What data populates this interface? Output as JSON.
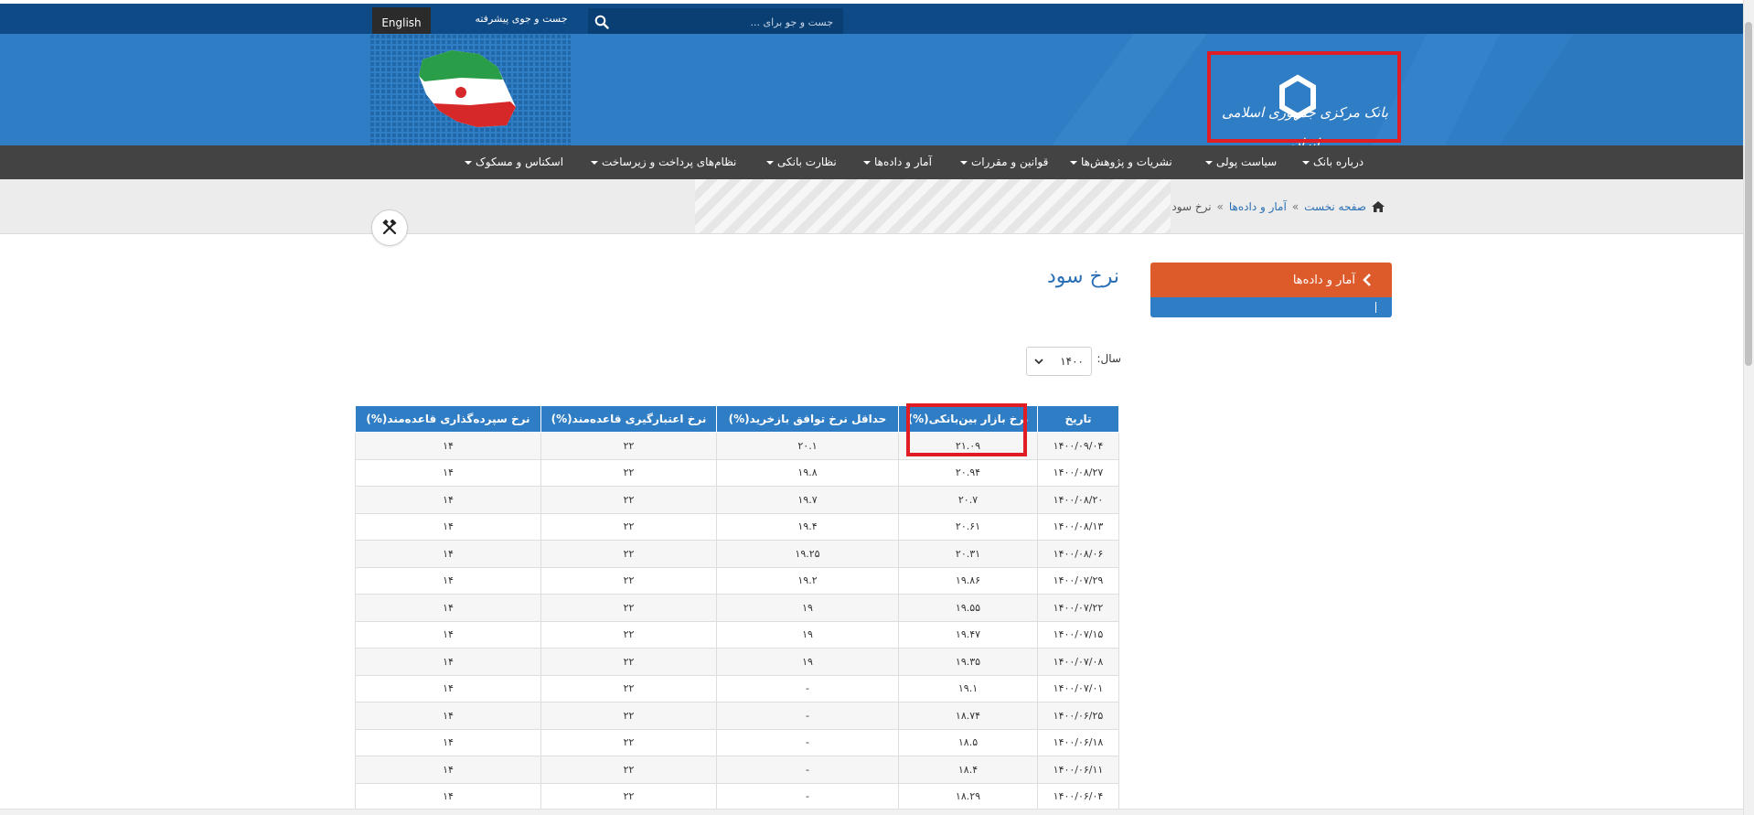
{
  "topbar": {
    "lang_label": "English",
    "advanced_search": "جست و جوی پیشرفته",
    "search_placeholder": "جست و جو برای ..."
  },
  "header": {
    "logo_text": "بانک مرکزی جمهوری اسلامی ایران"
  },
  "nav": {
    "items": [
      {
        "label": "درباره بانک",
        "dropdown": true
      },
      {
        "label": "سیاست پولی",
        "dropdown": true
      },
      {
        "label": "نشریات و پژوهش‌ها",
        "dropdown": true
      },
      {
        "label": "قوانین و مقررات",
        "dropdown": true
      },
      {
        "label": "آمار و داده‌ها",
        "dropdown": true
      },
      {
        "label": "نظارت بانکی",
        "dropdown": true
      },
      {
        "label": "نظام‌های پرداخت و زیرساخت",
        "dropdown": true
      },
      {
        "label": "اسکناس و مسکوک",
        "dropdown": true
      }
    ]
  },
  "breadcrumb": {
    "home": "صفحه نخست",
    "section": "آمار و داده‌ها",
    "current": "نرخ سود",
    "separator": "»"
  },
  "sidebar": {
    "header_label": "آمار و داده‌ها"
  },
  "main": {
    "title": "نرخ سود",
    "year_label": "سال:",
    "year_value": "۱۴۰۰"
  },
  "table": {
    "headers": [
      "تاریخ",
      "نرخ بازار بین‌بانکی(%)",
      "حداقل نرخ توافق بازخرید(%)",
      "نرخ اعتبارگیری قاعده‌مند(%)",
      "نرخ سپرده‌گذاری قاعده‌مند(%)"
    ],
    "rows": [
      [
        "۱۴۰۰/۰۹/۰۴",
        "۲۱.۰۹",
        "۲۰.۱",
        "۲۲",
        "۱۴"
      ],
      [
        "۱۴۰۰/۰۸/۲۷",
        "۲۰.۹۴",
        "۱۹.۸",
        "۲۲",
        "۱۴"
      ],
      [
        "۱۴۰۰/۰۸/۲۰",
        "۲۰.۷",
        "۱۹.۷",
        "۲۲",
        "۱۴"
      ],
      [
        "۱۴۰۰/۰۸/۱۳",
        "۲۰.۶۱",
        "۱۹.۴",
        "۲۲",
        "۱۴"
      ],
      [
        "۱۴۰۰/۰۸/۰۶",
        "۲۰.۳۱",
        "۱۹.۲۵",
        "۲۲",
        "۱۴"
      ],
      [
        "۱۴۰۰/۰۷/۲۹",
        "۱۹.۸۶",
        "۱۹.۲",
        "۲۲",
        "۱۴"
      ],
      [
        "۱۴۰۰/۰۷/۲۲",
        "۱۹.۵۵",
        "۱۹",
        "۲۲",
        "۱۴"
      ],
      [
        "۱۴۰۰/۰۷/۱۵",
        "۱۹.۴۷",
        "۱۹",
        "۲۲",
        "۱۴"
      ],
      [
        "۱۴۰۰/۰۷/۰۸",
        "۱۹.۳۵",
        "۱۹",
        "۲۲",
        "۱۴"
      ],
      [
        "۱۴۰۰/۰۷/۰۱",
        "۱۹.۱",
        "-",
        "۲۲",
        "۱۴"
      ],
      [
        "۱۴۰۰/۰۶/۲۵",
        "۱۸.۷۴",
        "-",
        "۲۲",
        "۱۴"
      ],
      [
        "۱۴۰۰/۰۶/۱۸",
        "۱۸.۵",
        "-",
        "۲۲",
        "۱۴"
      ],
      [
        "۱۴۰۰/۰۶/۱۱",
        "۱۸.۴",
        "-",
        "۲۲",
        "۱۴"
      ],
      [
        "۱۴۰۰/۰۶/۰۴",
        "۱۸.۲۹",
        "-",
        "۲۲",
        "۱۴"
      ]
    ]
  },
  "colors": {
    "brand_blue": "#2f7dc4",
    "top_blue": "#0e4a86",
    "nav_dark": "#434343",
    "accent_orange": "#dd5a2b",
    "highlight_red": "#e01c24"
  }
}
